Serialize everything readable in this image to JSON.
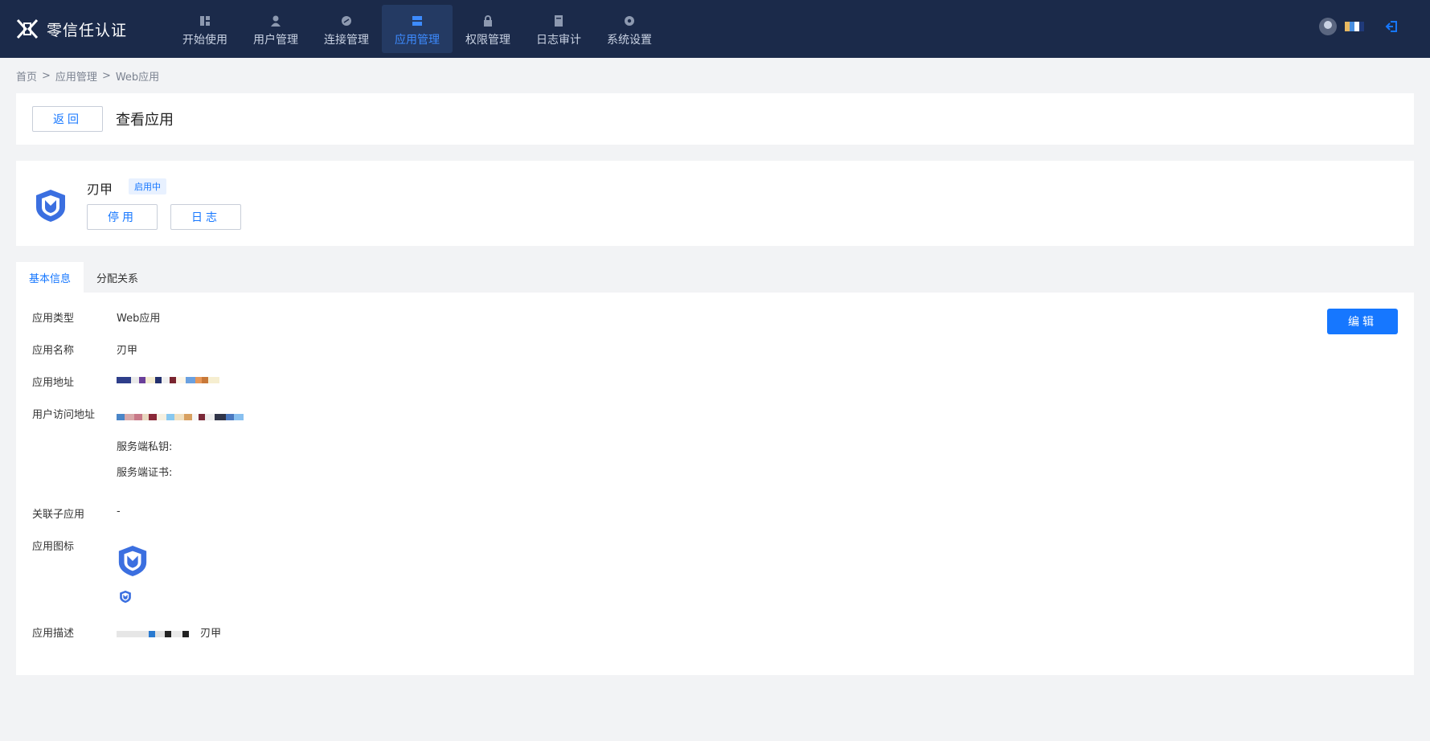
{
  "app": {
    "title": "零信任认证"
  },
  "nav": [
    {
      "label": "开始使用",
      "icon": "dashboard-icon"
    },
    {
      "label": "用户管理",
      "icon": "user-icon"
    },
    {
      "label": "连接管理",
      "icon": "connection-icon"
    },
    {
      "label": "应用管理",
      "icon": "app-icon",
      "active": true
    },
    {
      "label": "权限管理",
      "icon": "lock-icon"
    },
    {
      "label": "日志审计",
      "icon": "log-book-icon"
    },
    {
      "label": "系统设置",
      "icon": "gear-icon"
    }
  ],
  "breadcrumb": {
    "home": "首页",
    "section": "应用管理",
    "current": "Web应用",
    "sep": ">"
  },
  "header": {
    "back_label": "返回",
    "title": "查看应用"
  },
  "app_info": {
    "name": "刃甲",
    "status": "启用中",
    "disable_label": "停用",
    "log_label": "日志"
  },
  "tabs": [
    {
      "label": "基本信息",
      "active": true
    },
    {
      "label": "分配关系",
      "active": false
    }
  ],
  "details": {
    "edit_label": "编辑",
    "type_label": "应用类型",
    "type_value": "Web应用",
    "name_label": "应用名称",
    "name_value": "刃甲",
    "address_label": "应用地址",
    "access_label": "用户访问地址",
    "server_key_label": "服务端私钥:",
    "server_cert_label": "服务端证书:",
    "child_label": "关联子应用",
    "child_value": "-",
    "icon_label": "应用图标",
    "desc_label": "应用描述",
    "desc_value": "刃甲"
  },
  "colors": {
    "topbar": "#1b2a4a",
    "accent": "#1677ff",
    "logo_blue": "#3b6fe0"
  }
}
